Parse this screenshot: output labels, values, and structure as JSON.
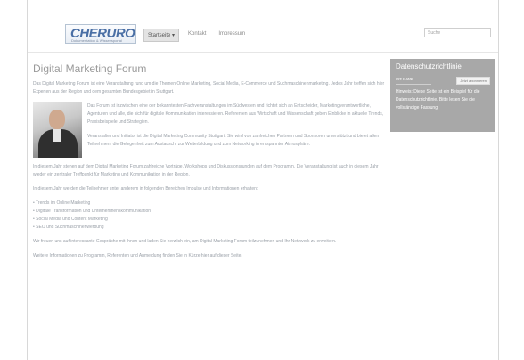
{
  "header": {
    "logo_text": "CHERURO",
    "logo_subtext": "Dokumentation & Wissensportal",
    "nav": [
      {
        "label": "Startseite ▾",
        "active": true
      },
      {
        "label": "Kontakt",
        "active": false
      },
      {
        "label": "Impressum",
        "active": false
      }
    ],
    "search_placeholder": "Suche"
  },
  "main": {
    "title": "Digital Marketing Forum",
    "intro": "Das Digital Marketing Forum ist eine Veranstaltung rund um die Themen Online Marketing, Social Media, E-Commerce und Suchmaschinenmarketing. Jedes Jahr treffen sich hier Experten aus der Region und dem gesamten Bundesgebiet in Stuttgart.",
    "photo_label": "Portrait",
    "para1": "Das Forum ist inzwischen eine der bekanntesten Fachveranstaltungen im Südwesten und richtet sich an Entscheider, Marketingverantwortliche, Agenturen und alle, die sich für digitale Kommunikation interessieren. Referenten aus Wirtschaft und Wissenschaft geben Einblicke in aktuelle Trends, Praxisbeispiele und Strategien.",
    "para2": "Veranstalter und Initiator ist die Digital Marketing Community Stuttgart. Sie wird von zahlreichen Partnern und Sponsoren unterstützt und bietet allen Teilnehmern die Gelegenheit zum Austausch, zur Weiterbildung und zum Networking in entspannter Atmosphäre.",
    "para3": "In diesem Jahr stehen auf dem Digital Marketing Forum zahlreiche Vorträge, Workshops und Diskussionsrunden auf dem Programm. Die Veranstaltung ist auch in diesem Jahr wieder ein zentraler Treffpunkt für Marketing und Kommunikation in der Region.",
    "para4": "In diesem Jahr werden die Teilnehmer unter anderem in folgenden Bereichen Impulse und Informationen erhalten:",
    "bullets": [
      "• Trends im Online Marketing",
      "• Digitale Transformation und Unternehmenskommunikation",
      "• Social Media und Content Marketing",
      "• SEO und Suchmaschinenwerbung"
    ],
    "para5": "Wir freuen uns auf interessante Gespräche mit Ihnen und laden Sie herzlich ein, am Digital Marketing Forum teilzunehmen und Ihr Netzwerk zu erweitern.",
    "para6": "Weitere Informationen zu Programm, Referenten und Anmeldung finden Sie in Kürze hier auf dieser Seite."
  },
  "sidebar": {
    "title": "Datenschutzrichtlinie",
    "field_label": "Ihre E-Mail",
    "button_label": "Jetzt abonnieren",
    "text": "Hinweis: Diese Seite ist ein Beispiel für die Datenschutzrichtlinie. Bitte lesen Sie die vollständige Fassung."
  }
}
